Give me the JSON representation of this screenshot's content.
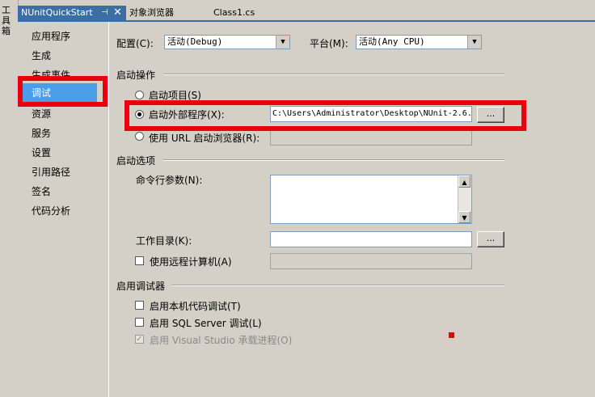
{
  "toolbox": {
    "label": "工具箱"
  },
  "tabs": {
    "active": {
      "label": "NUnitQuickStart",
      "pin": "⊣",
      "close": "✕"
    },
    "others": [
      "对象浏览器",
      "Class1.cs"
    ]
  },
  "sidebar": {
    "items": [
      "应用程序",
      "生成",
      "生成事件",
      "调试",
      "资源",
      "服务",
      "设置",
      "引用路径",
      "签名",
      "代码分析"
    ],
    "selected_index": 3
  },
  "config": {
    "config_label": "配置(C):",
    "config_value": "活动(Debug)",
    "platform_label": "平台(M):",
    "platform_value": "活动(Any CPU)"
  },
  "start_action": {
    "section_title": "启动操作",
    "start_project": "启动项目(S)",
    "start_external": "启动外部程序(X):",
    "external_path": "C:\\Users\\Administrator\\Desktop\\NUnit-2.6.",
    "browse_label": "...",
    "start_url": "使用 URL 启动浏览器(R):"
  },
  "start_options": {
    "section_title": "启动选项",
    "cmd_args": "命令行参数(N):",
    "working_dir": "工作目录(K):",
    "browse_label": "...",
    "remote_machine": "使用远程计算机(A)"
  },
  "debuggers": {
    "section_title": "启用调试器",
    "native_code": "启用本机代码调试(T)",
    "sql_server": "启用 SQL Server 调试(L)",
    "vs_host": "启用 Visual Studio 承载进程(O)",
    "vs_host_checked": true
  },
  "colors": {
    "accent": "#3a6ea5",
    "selection": "#4a9ee8",
    "highlight_red": "#e8000d",
    "background": "#d4d0c8"
  }
}
